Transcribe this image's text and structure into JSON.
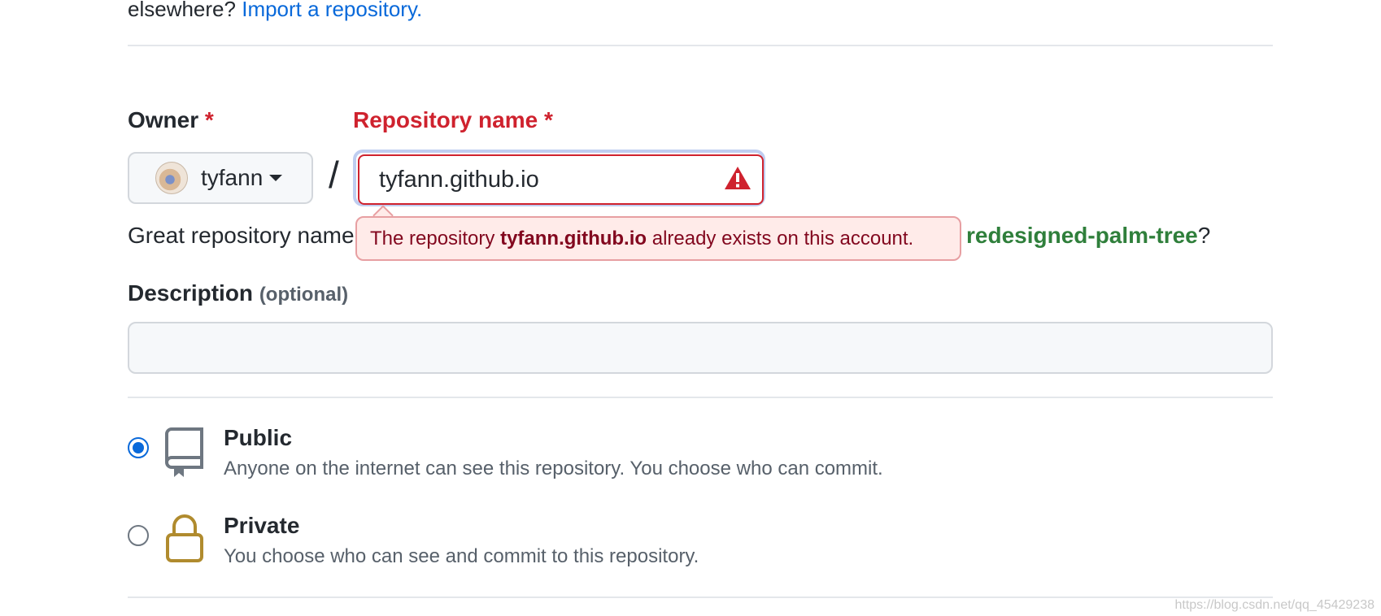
{
  "intro": {
    "prefix": "elsewhere?",
    "import_link": "Import a repository."
  },
  "owner": {
    "label": "Owner",
    "required_mark": "*",
    "selected": "tyfann"
  },
  "separator": "/",
  "repository": {
    "label": "Repository name",
    "required_mark": "*",
    "value": "tyfann.github.io",
    "error": {
      "prefix": "The repository",
      "name": "tyfann.github.io",
      "suffix": "already exists on this account."
    }
  },
  "suggestion": {
    "prefix": "Great repository name",
    "name": "redesigned-palm-tree",
    "suffix": "?"
  },
  "description": {
    "label": "Description",
    "optional": "(optional)",
    "value": ""
  },
  "visibility": [
    {
      "title": "Public",
      "desc": "Anyone on the internet can see this repository. You choose who can commit.",
      "selected": true,
      "icon": "repo-icon"
    },
    {
      "title": "Private",
      "desc": "You choose who can see and commit to this repository.",
      "selected": false,
      "icon": "lock-icon"
    }
  ],
  "watermark": "https://blog.csdn.net/qq_45429238",
  "colors": {
    "error": "#cf222e",
    "link": "#0969da",
    "suggestion": "#2f7f3b",
    "private_icon": "#b08b2e"
  }
}
